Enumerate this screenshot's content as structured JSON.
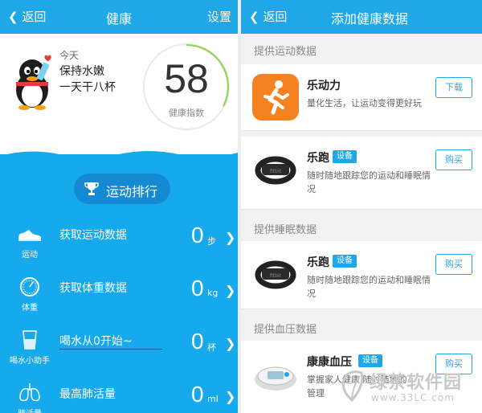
{
  "left": {
    "topbar": {
      "back": "返回",
      "title": "健康",
      "settings": "设置"
    },
    "today": "今天",
    "slogan_line1": "保持水嫩",
    "slogan_line2": "一天干八杯",
    "score": "58",
    "score_label": "健康指数",
    "rank_button": "运动排行",
    "rows": [
      {
        "icon": "shoe-icon",
        "icon_label": "运动",
        "label": "获取运动数据",
        "value": "0",
        "unit": "步"
      },
      {
        "icon": "scale-icon",
        "icon_label": "体重",
        "label": "获取体重数据",
        "value": "0",
        "unit": "kg"
      },
      {
        "icon": "water-cup-icon",
        "icon_label": "喝水小助手",
        "label": "喝水从0开始~",
        "value": "0",
        "unit": "杯"
      },
      {
        "icon": "lungs-icon",
        "icon_label": "肺活量",
        "label": "最高肺活量",
        "value": "0",
        "unit": "ml"
      }
    ]
  },
  "right": {
    "topbar": {
      "back": "返回",
      "title": "添加健康数据"
    },
    "sections": [
      {
        "title": "提供运动数据"
      },
      {
        "title": "提供睡眠数据"
      },
      {
        "title": "提供血压数据"
      }
    ],
    "cards": [
      {
        "name": "乐动力",
        "badge": "",
        "desc": "量化生活，让运动变得更好玩",
        "button": "下载",
        "icon": "running-app-icon"
      },
      {
        "name": "乐跑",
        "badge": "设备",
        "desc": "随时随地跟踪您的运动和睡眠情况",
        "button": "购买",
        "icon": "fitness-band-icon"
      },
      {
        "name": "乐跑",
        "badge": "设备",
        "desc": "随时随地跟踪您的运动和睡眠情况",
        "button": "购买",
        "icon": "fitness-band-icon"
      },
      {
        "name": "康康血压",
        "badge": "设备",
        "desc": "掌握家人健康 随时随地的 管理",
        "button": "购买",
        "icon": "blood-pressure-monitor-icon"
      }
    ]
  },
  "watermark": {
    "line1": "绿茶软件园",
    "line2": "www.33LC.com"
  },
  "colors": {
    "accent": "#1fa7e8",
    "blue_bg": "#16a9ec",
    "orange": "#f58220"
  }
}
